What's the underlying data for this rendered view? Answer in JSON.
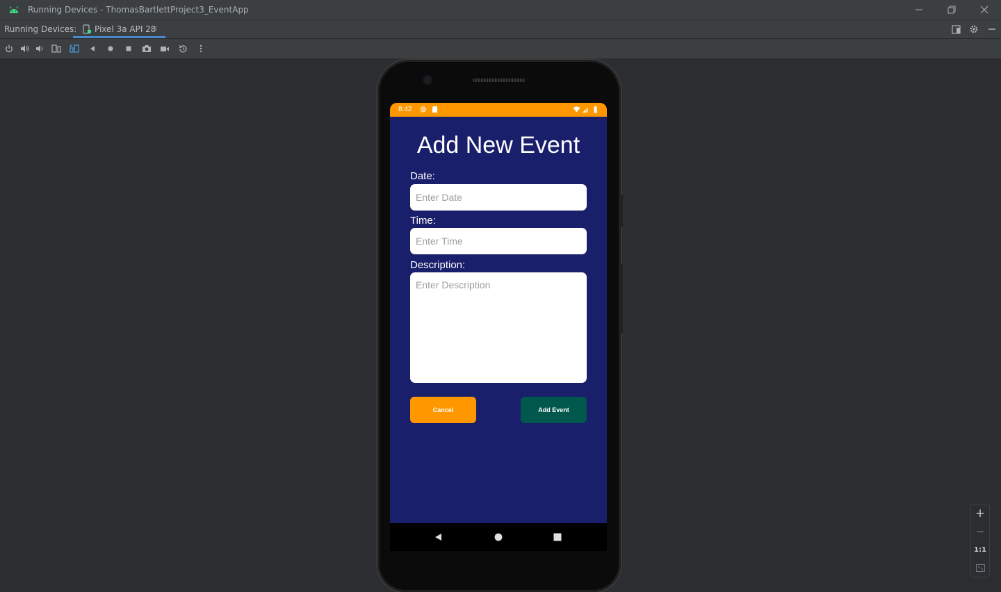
{
  "window": {
    "title": "Running Devices - ThomasBartlettProject3_EventApp",
    "app_icon": "android-icon",
    "controls": [
      "minimize-icon",
      "restore-icon",
      "close-icon"
    ]
  },
  "tool_window": {
    "label": "Running Devices:",
    "tab": {
      "label": "Pixel 3a API 28",
      "icon": "device-icon",
      "close": "×"
    },
    "right_icons": [
      "layout-icon",
      "gear-icon",
      "hide-icon"
    ]
  },
  "toolbar": {
    "icons": [
      "power-icon",
      "volume-up-icon",
      "volume-down-icon",
      "rotate-left-icon",
      "rotate-right-icon",
      "back-icon",
      "home-icon",
      "overview-icon",
      "screenshot-icon",
      "screen-record-icon",
      "reset-icon",
      "more-icon"
    ]
  },
  "device": {
    "status_bar": {
      "time": "8:42",
      "color": "#ff9800",
      "left_icons": [
        "settings-icon",
        "sd-card-icon"
      ],
      "right_icons": [
        "wifi-icon",
        "signal-icon",
        "battery-icon"
      ]
    },
    "screen_bg": "#1a1f6b",
    "title": "Add New Event",
    "date": {
      "label": "Date:",
      "placeholder": "Enter Date",
      "value": ""
    },
    "time": {
      "label": "Time:",
      "placeholder": "Enter Time",
      "value": ""
    },
    "description": {
      "label": "Description:",
      "placeholder": "Enter Description",
      "value": ""
    },
    "buttons": {
      "cancel": {
        "label": "Cancel",
        "color": "#ff9800"
      },
      "add": {
        "label": "Add Event",
        "color": "#00574b"
      }
    },
    "nav_bar": [
      "nav-back-icon",
      "nav-home-icon",
      "nav-recents-icon"
    ]
  },
  "zoom": {
    "zoom_in": "+",
    "zoom_out": "−",
    "actual_size": "1:1",
    "fit": "fit-screen-icon"
  }
}
